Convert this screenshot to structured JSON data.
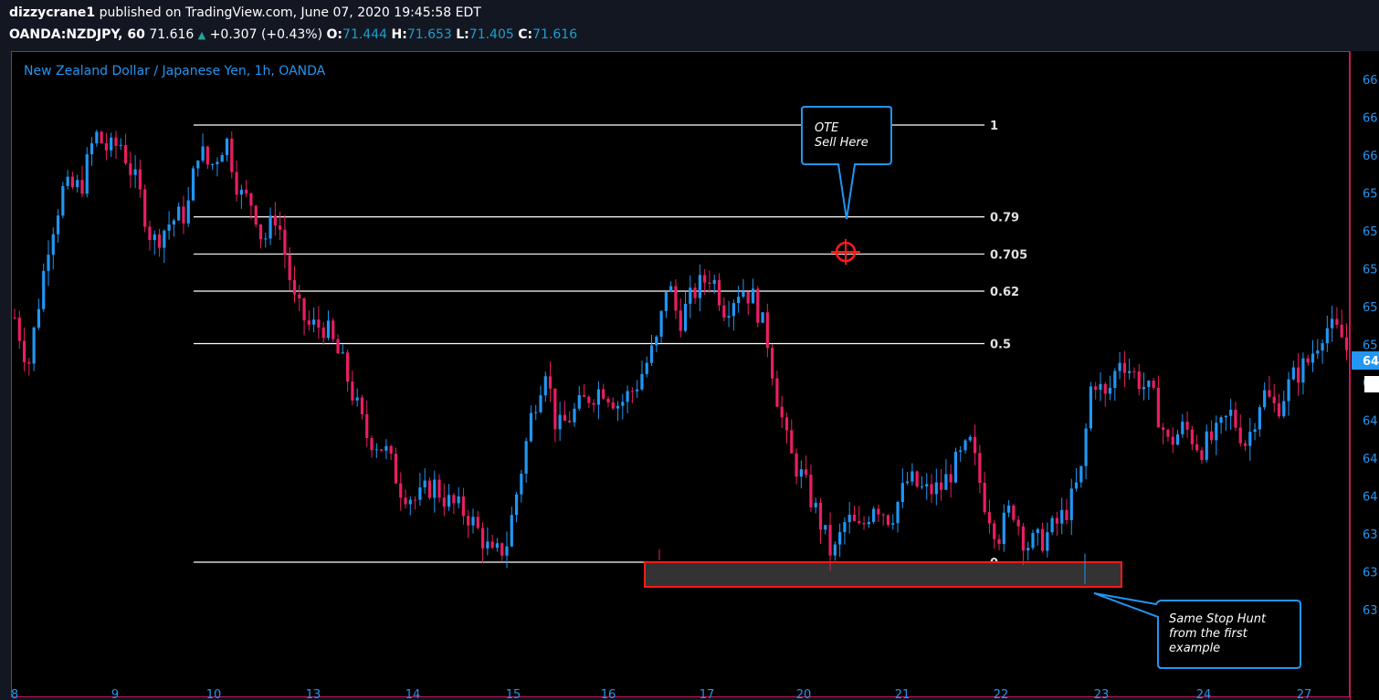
{
  "header": {
    "author": "dizzycrane1",
    "published": "published on TradingView.com, June 07, 2020 19:45:58 EDT",
    "symbol": "OANDA:NZDJPY, 60",
    "last": "71.616",
    "change": "+0.307 (+0.43%)",
    "open_label": "O:",
    "open": "71.444",
    "high_label": "H:",
    "high": "71.653",
    "low_label": "L:",
    "low": "71.405",
    "close_label": "C:",
    "close": "71.616"
  },
  "chart_title": "New Zealand Dollar / Japanese Yen, 1h, OANDA",
  "annotations": {
    "ote_line1": "OTE",
    "ote_line2": "Sell Here",
    "stop_line1": "Same Stop Hunt",
    "stop_line2": "from the first",
    "stop_line3": "example"
  },
  "colors": {
    "up": "#2196f3",
    "down": "#e91e63",
    "fib": "#ffffff",
    "frame": "#c2185b",
    "box_fill": "#333333",
    "box_border": "#ff1a1a"
  },
  "chart_data": {
    "type": "candlestick",
    "x_axis_labels": [
      "8",
      "9",
      "10",
      "13",
      "14",
      "15",
      "16",
      "17",
      "20",
      "21",
      "22",
      "23",
      "24",
      "27"
    ],
    "right_axis_labels": [
      "66",
      "66",
      "66",
      "65",
      "65",
      "65",
      "65",
      "65",
      "64",
      "64",
      "64",
      "64",
      "63",
      "63",
      "63"
    ],
    "current_price_tag": "64",
    "fib_levels": [
      {
        "label": "1",
        "level": 1.0
      },
      {
        "label": "0.79",
        "level": 0.79
      },
      {
        "label": "0.705",
        "level": 0.705
      },
      {
        "label": "0.62",
        "level": 0.62
      },
      {
        "label": "0.5",
        "level": 0.5
      },
      {
        "label": "0",
        "level": 0.0
      }
    ],
    "path_points": [
      [
        0,
        0.56
      ],
      [
        12,
        0.45
      ],
      [
        30,
        0.74
      ],
      [
        42,
        0.85
      ],
      [
        58,
        0.86
      ],
      [
        70,
        0.98
      ],
      [
        82,
        0.94
      ],
      [
        92,
        0.96
      ],
      [
        108,
        0.85
      ],
      [
        120,
        0.73
      ],
      [
        136,
        0.78
      ],
      [
        150,
        0.8
      ],
      [
        160,
        0.95
      ],
      [
        170,
        0.9
      ],
      [
        184,
        0.97
      ],
      [
        196,
        0.84
      ],
      [
        208,
        0.82
      ],
      [
        216,
        0.73
      ],
      [
        228,
        0.8
      ],
      [
        244,
        0.59
      ],
      [
        256,
        0.54
      ],
      [
        270,
        0.54
      ],
      [
        286,
        0.45
      ],
      [
        306,
        0.29
      ],
      [
        322,
        0.26
      ],
      [
        336,
        0.17
      ],
      [
        350,
        0.14
      ],
      [
        364,
        0.18
      ],
      [
        376,
        0.14
      ],
      [
        394,
        0.11
      ],
      [
        406,
        0.06
      ],
      [
        416,
        0.01
      ],
      [
        428,
        0.04
      ],
      [
        440,
        0.2
      ],
      [
        450,
        0.34
      ],
      [
        462,
        0.45
      ],
      [
        472,
        0.3
      ],
      [
        486,
        0.34
      ],
      [
        500,
        0.38
      ],
      [
        512,
        0.4
      ],
      [
        526,
        0.36
      ],
      [
        540,
        0.4
      ],
      [
        560,
        0.51
      ],
      [
        568,
        0.65
      ],
      [
        578,
        0.55
      ],
      [
        592,
        0.62
      ],
      [
        606,
        0.66
      ],
      [
        618,
        0.58
      ],
      [
        632,
        0.63
      ],
      [
        644,
        0.6
      ],
      [
        656,
        0.5
      ],
      [
        662,
        0.4
      ],
      [
        674,
        0.25
      ],
      [
        686,
        0.19
      ],
      [
        700,
        0.1
      ],
      [
        712,
        0.01
      ],
      [
        724,
        0.1
      ],
      [
        736,
        0.07
      ],
      [
        748,
        0.14
      ],
      [
        762,
        0.1
      ],
      [
        778,
        0.19
      ],
      [
        792,
        0.16
      ],
      [
        806,
        0.17
      ],
      [
        818,
        0.22
      ],
      [
        832,
        0.27
      ],
      [
        844,
        0.14
      ],
      [
        856,
        0.06
      ],
      [
        868,
        0.13
      ],
      [
        880,
        0.04
      ],
      [
        894,
        0.05
      ],
      [
        908,
        0.09
      ],
      [
        918,
        0.13
      ],
      [
        928,
        0.2
      ],
      [
        938,
        0.43
      ],
      [
        950,
        0.37
      ],
      [
        962,
        0.47
      ],
      [
        974,
        0.43
      ],
      [
        990,
        0.38
      ],
      [
        1004,
        0.27
      ],
      [
        1018,
        0.31
      ],
      [
        1032,
        0.26
      ],
      [
        1046,
        0.29
      ],
      [
        1058,
        0.34
      ],
      [
        1072,
        0.27
      ],
      [
        1086,
        0.39
      ],
      [
        1098,
        0.35
      ],
      [
        1112,
        0.42
      ],
      [
        1126,
        0.46
      ],
      [
        1140,
        0.54
      ],
      [
        1154,
        0.52
      ],
      [
        1162,
        0.47
      ]
    ],
    "x_range": [
      0,
      1162
    ],
    "level_range": [
      -0.42,
      1.22
    ]
  }
}
